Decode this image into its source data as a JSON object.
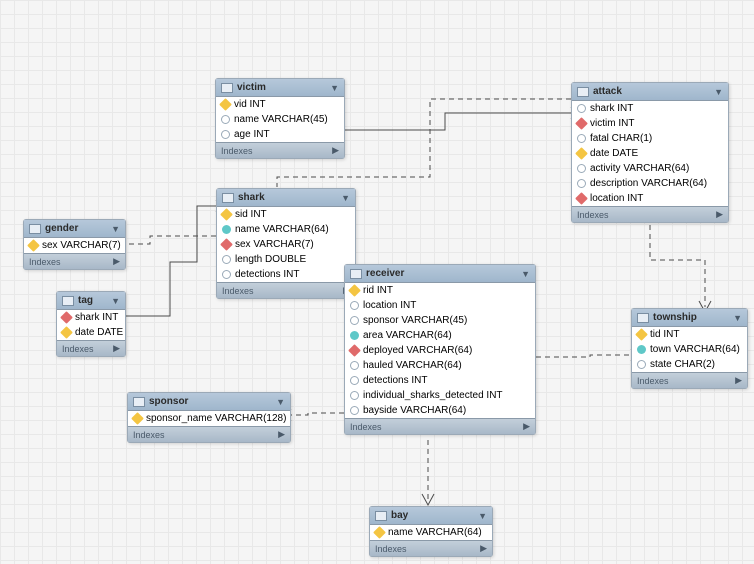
{
  "diagram_type": "entity-relationship",
  "grid": true,
  "labels": {
    "indexes": "Indexes"
  },
  "entities": {
    "victim": {
      "title": "victim",
      "fields": [
        {
          "icon": "key",
          "text": "vid INT"
        },
        {
          "icon": "hollow",
          "text": "name VARCHAR(45)"
        },
        {
          "icon": "hollow",
          "text": "age INT"
        }
      ]
    },
    "attack": {
      "title": "attack",
      "fields": [
        {
          "icon": "hollow",
          "text": "shark INT"
        },
        {
          "icon": "red",
          "text": "victim INT"
        },
        {
          "icon": "hollow",
          "text": "fatal CHAR(1)"
        },
        {
          "icon": "key",
          "text": "date DATE"
        },
        {
          "icon": "hollow",
          "text": "activity VARCHAR(64)"
        },
        {
          "icon": "hollow",
          "text": "description VARCHAR(64)"
        },
        {
          "icon": "red",
          "text": "location INT"
        }
      ]
    },
    "shark": {
      "title": "shark",
      "fields": [
        {
          "icon": "key",
          "text": "sid INT"
        },
        {
          "icon": "cyan",
          "text": "name VARCHAR(64)"
        },
        {
          "icon": "red",
          "text": "sex VARCHAR(7)"
        },
        {
          "icon": "hollow",
          "text": "length DOUBLE"
        },
        {
          "icon": "hollow",
          "text": "detections INT"
        }
      ]
    },
    "gender": {
      "title": "gender",
      "fields": [
        {
          "icon": "key",
          "text": "sex VARCHAR(7)"
        }
      ]
    },
    "tag": {
      "title": "tag",
      "fields": [
        {
          "icon": "red",
          "text": "shark INT"
        },
        {
          "icon": "key",
          "text": "date DATE"
        }
      ]
    },
    "receiver": {
      "title": "receiver",
      "fields": [
        {
          "icon": "key",
          "text": "rid INT"
        },
        {
          "icon": "hollow",
          "text": "location INT"
        },
        {
          "icon": "hollow",
          "text": "sponsor VARCHAR(45)"
        },
        {
          "icon": "cyan",
          "text": "area VARCHAR(64)"
        },
        {
          "icon": "red",
          "text": "deployed VARCHAR(64)"
        },
        {
          "icon": "hollow",
          "text": "hauled VARCHAR(64)"
        },
        {
          "icon": "hollow",
          "text": "detections INT"
        },
        {
          "icon": "hollow",
          "text": "individual_sharks_detected INT"
        },
        {
          "icon": "hollow",
          "text": "bayside VARCHAR(64)"
        }
      ]
    },
    "township": {
      "title": "township",
      "fields": [
        {
          "icon": "key",
          "text": "tid INT"
        },
        {
          "icon": "cyan",
          "text": "town VARCHAR(64)"
        },
        {
          "icon": "hollow",
          "text": "state CHAR(2)"
        }
      ]
    },
    "sponsor": {
      "title": "sponsor",
      "fields": [
        {
          "icon": "key",
          "text": "sponsor_name VARCHAR(128)"
        }
      ]
    },
    "bay": {
      "title": "bay",
      "fields": [
        {
          "icon": "key",
          "text": "name VARCHAR(64)"
        }
      ]
    }
  },
  "relationships": [
    {
      "from": "attack.victim",
      "to": "victim.vid",
      "style": "solid"
    },
    {
      "from": "attack.shark",
      "to": "shark.sid",
      "style": "dashed"
    },
    {
      "from": "attack.location",
      "to": "township.tid",
      "style": "dashed"
    },
    {
      "from": "shark.sex",
      "to": "gender.sex",
      "style": "dashed"
    },
    {
      "from": "tag.shark",
      "to": "shark.sid",
      "style": "solid"
    },
    {
      "from": "receiver.location",
      "to": "township.tid",
      "style": "dashed"
    },
    {
      "from": "receiver.sponsor",
      "to": "sponsor.sponsor_name",
      "style": "dashed"
    },
    {
      "from": "receiver.bayside",
      "to": "bay.name",
      "style": "dashed"
    }
  ]
}
